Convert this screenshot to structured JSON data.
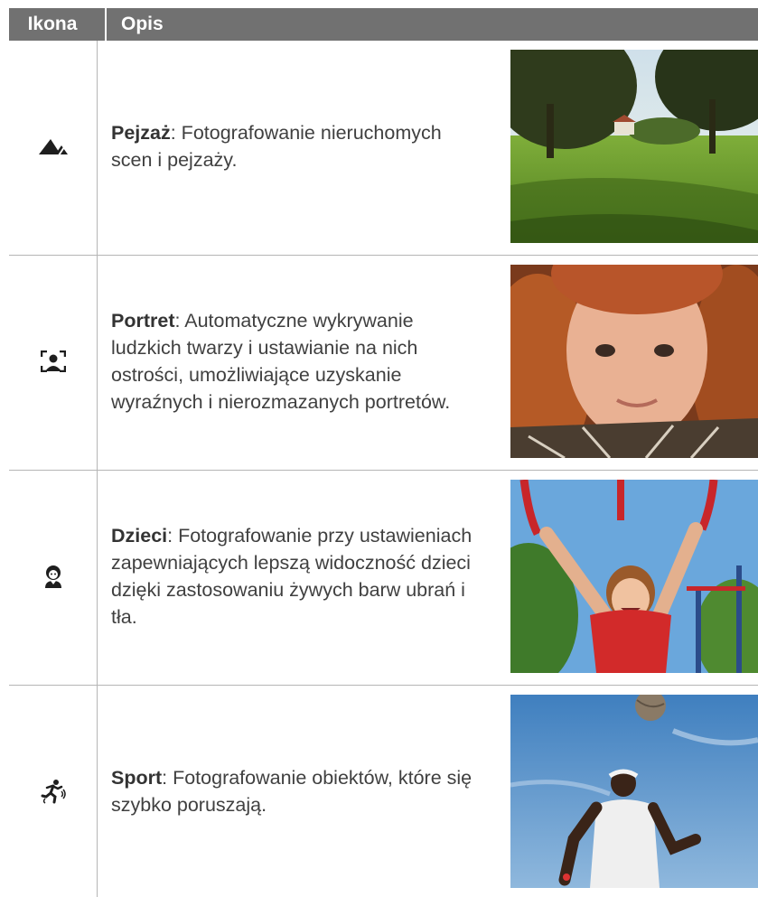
{
  "table": {
    "header": {
      "icon_col": "Ikona",
      "desc_col": "Opis"
    },
    "rows": [
      {
        "icon": "landscape-icon",
        "name": "Pejzaż",
        "description": ": Fotografowanie nieruchomych scen i pejzaży."
      },
      {
        "icon": "portrait-face-detect-icon",
        "name": "Portret",
        "description": ": Automatyczne wykrywanie ludzkich twarzy i ustawianie na nich ostrości, umożliwiające uzyskanie wyraźnych i nierozmazanych portretów."
      },
      {
        "icon": "children-icon",
        "name": "Dzieci",
        "description": ": Fotografowanie przy ustawieniach zapewniających lepszą widoczność dzieci dzięki zastosowaniu żywych barw ubrań i tła."
      },
      {
        "icon": "sport-runner-icon",
        "name": "Sport",
        "description": ": Fotografowanie obiektów, które się szybko poruszają."
      }
    ]
  },
  "colors": {
    "header_bg": "#717171",
    "text": "#404040",
    "rule": "#b5b5b5"
  }
}
